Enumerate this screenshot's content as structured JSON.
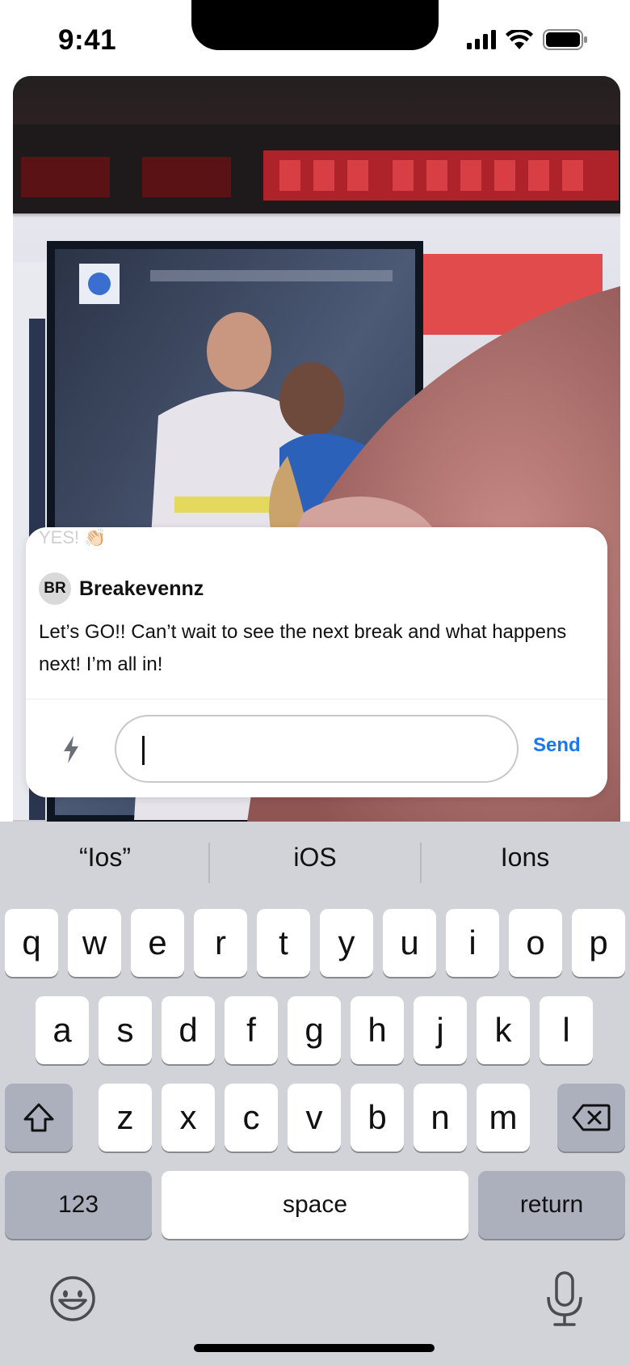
{
  "status_bar": {
    "time": "9:41"
  },
  "chat": {
    "faded_message": "YES! 👏🏻",
    "message": {
      "avatar_initials": "BR",
      "username": "Breakevennz",
      "text": "Let’s GO!! Can’t wait to see the next break and what happens next! I’m all in!"
    },
    "input": {
      "value": "",
      "placeholder": ""
    },
    "send_label": "Send",
    "accent_color": "#1877f2"
  },
  "keyboard": {
    "suggestions": [
      "“Ios”",
      "iOS",
      "Ions"
    ],
    "row1": [
      "q",
      "w",
      "e",
      "r",
      "t",
      "y",
      "u",
      "i",
      "o",
      "p"
    ],
    "row2": [
      "a",
      "s",
      "d",
      "f",
      "g",
      "h",
      "j",
      "k",
      "l"
    ],
    "row3": [
      "z",
      "x",
      "c",
      "v",
      "b",
      "n",
      "m"
    ],
    "numbers_label": "123",
    "space_label": "space",
    "return_label": "return",
    "shift_icon": "shift-icon",
    "delete_icon": "delete-icon",
    "emoji_icon": "emoji-icon",
    "mic_icon": "microphone-icon"
  }
}
